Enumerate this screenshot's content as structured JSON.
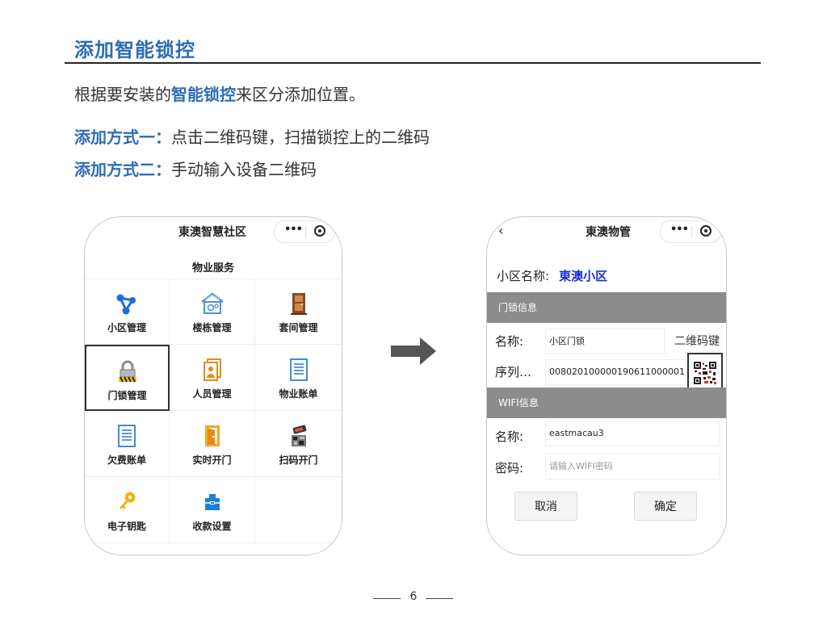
{
  "document": {
    "title": "添加智能锁控",
    "intro_pre": "根据要安装的",
    "intro_highlight": "智能锁控",
    "intro_post": "来区分添加位置。",
    "method1_label": "添加方式一：",
    "method1_text": "点击二维码键，扫描锁控上的二维码",
    "method2_label": "添加方式二：",
    "method2_text": "手动输入设备二维码",
    "page_number": "6"
  },
  "left_phone": {
    "app_title": "東澳智慧社区",
    "section_title": "物业服务",
    "menu": [
      {
        "label": "小区管理",
        "icon": "network-icon"
      },
      {
        "label": "楼栋管理",
        "icon": "building-gear-icon"
      },
      {
        "label": "套间管理",
        "icon": "door-icon"
      },
      {
        "label": "门锁管理",
        "icon": "padlock-icon"
      },
      {
        "label": "人员管理",
        "icon": "people-card-icon"
      },
      {
        "label": "物业账单",
        "icon": "bill-list-icon"
      },
      {
        "label": "欠费账单",
        "icon": "arrears-list-icon"
      },
      {
        "label": "实时开门",
        "icon": "open-door-icon"
      },
      {
        "label": "扫码开门",
        "icon": "phone-scan-icon"
      },
      {
        "label": "电子钥匙",
        "icon": "key-icon"
      },
      {
        "label": "收款设置",
        "icon": "payment-settings-icon"
      }
    ]
  },
  "right_phone": {
    "app_title": "東澳物管",
    "community_label": "小区名称:",
    "community_value": "東澳小区",
    "lock_section": "门锁信息",
    "lock_name_label": "名称:",
    "lock_name_value": "小区门锁",
    "qr_key_label": "二维码键",
    "serial_label": "序列…",
    "serial_value": "008020100000190611000001",
    "wifi_section": "WIFI信息",
    "wifi_name_label": "名称:",
    "wifi_name_value": "eastmacau3",
    "wifi_pwd_label": "密码:",
    "wifi_pwd_placeholder": "请输入WIFI密码",
    "cancel_label": "取消",
    "confirm_label": "确定"
  },
  "colors": {
    "accent_blue": "#2e6db4",
    "community_blue": "#1a2ee0",
    "band_gray": "#8c8c8c"
  }
}
